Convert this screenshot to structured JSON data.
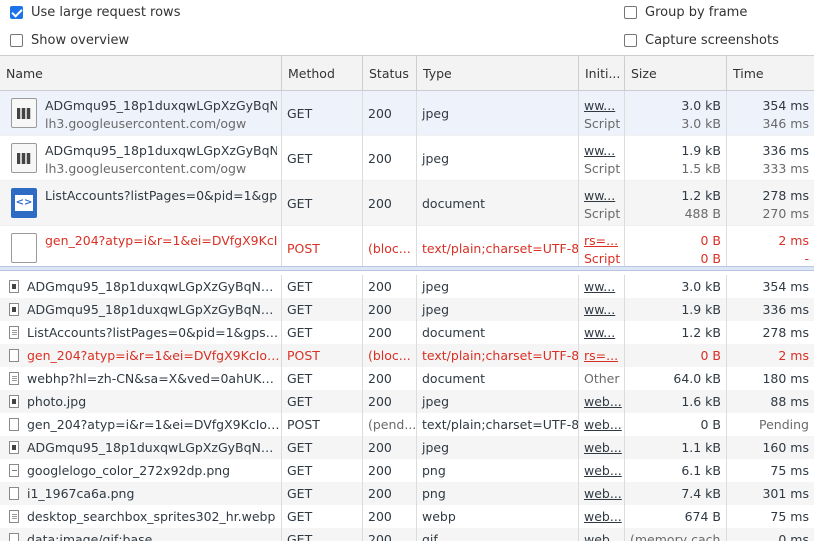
{
  "settings": {
    "large_rows_label": "Use large request rows",
    "large_rows_checked": true,
    "overview_label": "Show overview",
    "overview_checked": false,
    "group_frame_label": "Group by frame",
    "group_frame_checked": false,
    "capture_label": "Capture screenshots",
    "capture_checked": false
  },
  "columns": {
    "name": "Name",
    "method": "Method",
    "status": "Status",
    "type": "Type",
    "initiator": "Initi...",
    "size": "Size",
    "time": "Time"
  },
  "large_rows": [
    {
      "icon": "image-file-icon",
      "name": "ADGmqu95_18p1duxqwLGpXzGyBqN...",
      "domain": "lh3.googleusercontent.com/ogw",
      "method": "GET",
      "status": "200",
      "type": "jpeg",
      "initiator": "ww...",
      "initiator_sub": "Script",
      "size": "3.0 kB",
      "size_sub": "3.0 kB",
      "time": "354 ms",
      "time_sub": "346 ms",
      "error": false
    },
    {
      "icon": "image-file-icon",
      "name": "ADGmqu95_18p1duxqwLGpXzGyBqN...",
      "domain": "lh3.googleusercontent.com/ogw",
      "method": "GET",
      "status": "200",
      "type": "jpeg",
      "initiator": "ww...",
      "initiator_sub": "Script",
      "size": "1.9 kB",
      "size_sub": "1.5 kB",
      "time": "336 ms",
      "time_sub": "333 ms",
      "error": false
    },
    {
      "icon": "document-file-icon",
      "name": "ListAccounts?listPages=0&pid=1&gp...",
      "domain": "",
      "method": "GET",
      "status": "200",
      "type": "document",
      "initiator": "ww...",
      "initiator_sub": "Script",
      "size": "1.2 kB",
      "size_sub": "488 B",
      "time": "278 ms",
      "time_sub": "270 ms",
      "error": false
    },
    {
      "icon": "blank-file-icon",
      "name": "gen_204?atyp=i&r=1&ei=DVfgX9KcI...",
      "domain": "",
      "method": "POST",
      "status": "(bloc...",
      "type": "text/plain;charset=UTF-8",
      "initiator": "rs=...",
      "initiator_sub": "Script",
      "size": "0 B",
      "size_sub": "0 B",
      "time": "2 ms",
      "time_sub": "-",
      "error": true
    }
  ],
  "small_rows": [
    {
      "icon": "img",
      "name": "ADGmqu95_18p1duxqwLGpXzGyBqNEIh...",
      "method": "GET",
      "status": "200",
      "type": "jpeg",
      "initiator": "ww...",
      "initiator_link": true,
      "size": "3.0 kB",
      "time": "354 ms",
      "error": false
    },
    {
      "icon": "img",
      "name": "ADGmqu95_18p1duxqwLGpXzGyBqNEIh...",
      "method": "GET",
      "status": "200",
      "type": "jpeg",
      "initiator": "ww...",
      "initiator_link": true,
      "size": "1.9 kB",
      "time": "336 ms",
      "error": false
    },
    {
      "icon": "doc",
      "name": "ListAccounts?listPages=0&pid=1&gpsia...",
      "method": "GET",
      "status": "200",
      "type": "document",
      "initiator": "ww...",
      "initiator_link": true,
      "size": "1.2 kB",
      "time": "278 ms",
      "error": false
    },
    {
      "icon": "blank",
      "name": "gen_204?atyp=i&r=1&ei=DVfgX9KcIov2...",
      "method": "POST",
      "status": "(bloc...",
      "type": "text/plain;charset=UTF-8",
      "initiator": "rs=...",
      "initiator_link": true,
      "size": "0 B",
      "time": "2 ms",
      "error": true
    },
    {
      "icon": "doc",
      "name": "webhp?hl=zh-CN&sa=X&ved=0ahUKEwi...",
      "method": "GET",
      "status": "200",
      "type": "document",
      "initiator": "Other",
      "initiator_link": false,
      "size": "64.0 kB",
      "time": "180 ms",
      "error": false
    },
    {
      "icon": "img",
      "name": "photo.jpg",
      "method": "GET",
      "status": "200",
      "type": "jpeg",
      "initiator": "web...",
      "initiator_link": true,
      "size": "1.6 kB",
      "time": "88 ms",
      "error": false
    },
    {
      "icon": "blank",
      "name": "gen_204?atyp=i&r=1&ei=DVfgX9KcIov2...",
      "method": "POST",
      "status": "(pend...",
      "type": "text/plain;charset=UTF-8",
      "initiator": "web...",
      "initiator_link": true,
      "size": "0 B",
      "time": "Pending",
      "error": false,
      "pending": true
    },
    {
      "icon": "img",
      "name": "ADGmqu95_18p1duxqwLGpXzGyBqNEIh...",
      "method": "GET",
      "status": "200",
      "type": "jpeg",
      "initiator": "web...",
      "initiator_link": true,
      "size": "1.1 kB",
      "time": "160 ms",
      "error": false
    },
    {
      "icon": "png",
      "name": "googlelogo_color_272x92dp.png",
      "method": "GET",
      "status": "200",
      "type": "png",
      "initiator": "web...",
      "initiator_link": true,
      "size": "6.1 kB",
      "time": "75 ms",
      "error": false
    },
    {
      "icon": "blank",
      "name": "i1_1967ca6a.png",
      "method": "GET",
      "status": "200",
      "type": "png",
      "initiator": "web...",
      "initiator_link": true,
      "size": "7.4 kB",
      "time": "301 ms",
      "error": false
    },
    {
      "icon": "doc",
      "name": "desktop_searchbox_sprites302_hr.webp",
      "method": "GET",
      "status": "200",
      "type": "webp",
      "initiator": "web...",
      "initiator_link": true,
      "size": "674 B",
      "time": "75 ms",
      "error": false
    },
    {
      "icon": "blank",
      "name": "data:image/gif;base...",
      "method": "GET",
      "status": "200",
      "type": "gif",
      "initiator": "web...",
      "initiator_link": true,
      "size": "(memory cach...",
      "time": "0 ms",
      "error": false
    }
  ]
}
